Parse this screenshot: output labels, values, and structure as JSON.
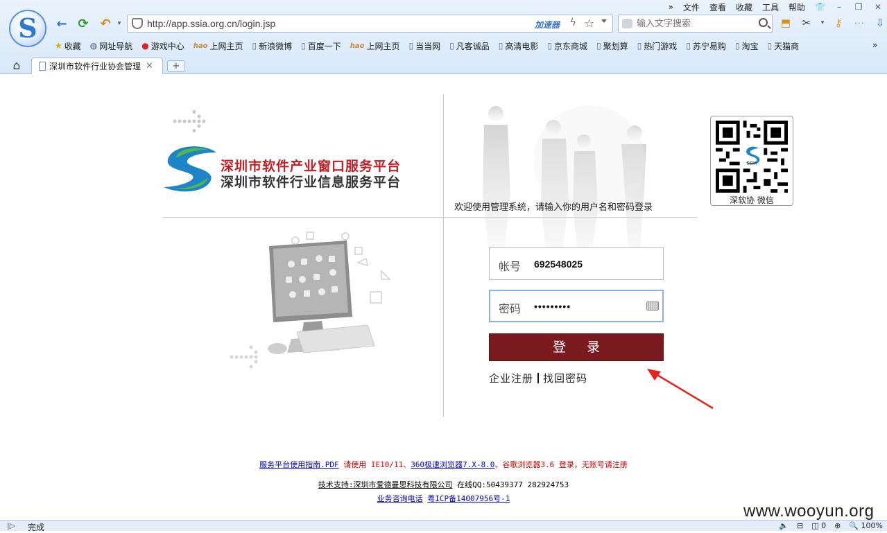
{
  "browser": {
    "menu": [
      "文件",
      "查看",
      "收藏",
      "工具",
      "帮助"
    ],
    "menu_more": "»",
    "url": "http://app.ssia.org.cn/login.jsp",
    "accelerator": "加速器",
    "search_placeholder": "输入文字搜索",
    "favorites_more": "»",
    "favorites": [
      {
        "label": "收藏",
        "icon": "star-icon"
      },
      {
        "label": "网址导航",
        "icon": "globe-icon"
      },
      {
        "label": "游戏中心",
        "icon": "game-icon"
      },
      {
        "label": "上网主页",
        "icon": "hao-icon"
      },
      {
        "label": "新浪微博",
        "icon": "page-icon"
      },
      {
        "label": "百度一下",
        "icon": "page-icon"
      },
      {
        "label": "上网主页",
        "icon": "hao-icon"
      },
      {
        "label": "当当网",
        "icon": "page-icon"
      },
      {
        "label": "凡客诚品",
        "icon": "page-icon"
      },
      {
        "label": "高清电影",
        "icon": "page-icon"
      },
      {
        "label": "京东商城",
        "icon": "page-icon"
      },
      {
        "label": "聚划算",
        "icon": "page-icon"
      },
      {
        "label": "热门游戏",
        "icon": "page-icon"
      },
      {
        "label": "苏宁易购",
        "icon": "page-icon"
      },
      {
        "label": "淘宝",
        "icon": "page-icon"
      },
      {
        "label": "天猫商",
        "icon": "page-icon"
      }
    ],
    "tab_title": "深圳市软件行业协会管理",
    "status_text": "完成",
    "status_count": "0",
    "zoom": "100%"
  },
  "page": {
    "brand_line1": "深圳市软件产业窗口服务平台",
    "brand_line2": "深圳市软件行业信息服务平台",
    "welcome": "欢迎使用管理系统，请输入你的用户名和密码登录",
    "qr_caption": "深软协 微信",
    "qr_logo_text": "SSIA",
    "account_label": "帐号",
    "account_value": "692548025",
    "password_label": "密码",
    "password_value": "•••••••••",
    "login_button": "登 录",
    "register_link": "企业注册",
    "recover_link": "找回密码"
  },
  "footer": {
    "guide_link": "服务平台使用指南.PDF",
    "use_text": " 请使用 ",
    "ie_text": "IE10/11、",
    "browser360_link": "360极速浏览器7.X-8.0",
    "chrome_text": "、谷歌浏览器3.6 登录，无账号请注册",
    "support_link": "技术支持:深圳市爱德曼思科技有限公司",
    "qq_text": " 在线QQ:50439377 282924753",
    "phone_link": "业务咨询电话",
    "icp_link": "粤ICP备14007956号-1"
  },
  "watermark": "www.wooyun.org",
  "colors": {
    "brand_red": "#c21d22",
    "login_button": "#7a1a1f",
    "link_blue": "#0000cc",
    "notice_red": "#cc0000",
    "annotation_arrow": "#e8201e"
  }
}
